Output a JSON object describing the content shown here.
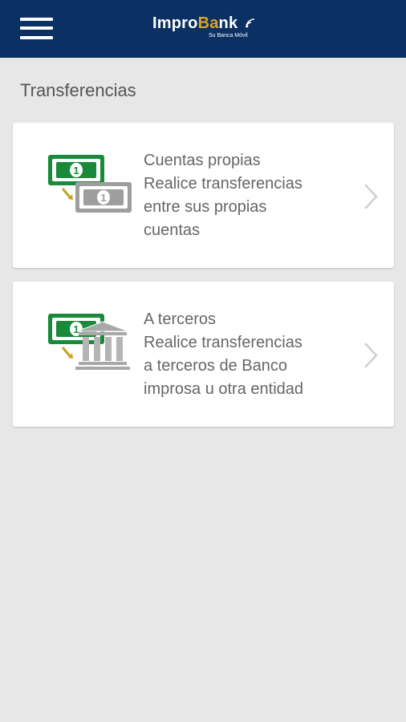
{
  "header": {
    "menu_icon": "hamburger-menu-icon",
    "logo": {
      "word_prefix": "Impro",
      "word_bank_b": "B",
      "word_bank_lock": "a",
      "word_bank_rest": "nk",
      "tagline": "Su Banca Móvil",
      "brand_color": "#0b3063",
      "accent_color": "#d9a421"
    }
  },
  "section_title": "Transferencias",
  "options": [
    {
      "icon": "own-accounts-transfer-icon",
      "title": "Cuentas propias",
      "description_lines": [
        "Realice transferencias",
        "entre sus propias",
        "cuentas"
      ]
    },
    {
      "icon": "third-party-transfer-icon",
      "title": "A terceros",
      "description_lines": [
        "Realice transferencias",
        "a terceros de Banco",
        "improsa u otra entidad"
      ]
    }
  ],
  "colors": {
    "money_green": "#1a8a3a",
    "money_gray": "#9e9e9e",
    "arrow_gold": "#c9a21a"
  }
}
